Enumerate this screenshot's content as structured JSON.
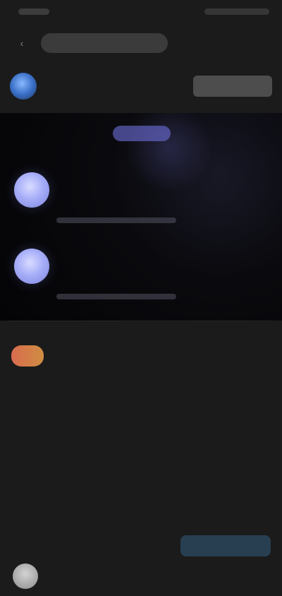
{
  "status_bar": {
    "time": "",
    "indicators": ""
  },
  "top_bar": {
    "title": "",
    "back_icon": "chevron-left-icon"
  },
  "channel": {
    "name": "",
    "subtitle": "",
    "button": ""
  },
  "hero": {
    "chip": "",
    "caption": "",
    "poll_1": {
      "title": "",
      "subtitle": ""
    },
    "poll_2": {
      "title": "",
      "subtitle": ""
    }
  },
  "body": {
    "paragraph_1": "",
    "paragraph_2": "",
    "paragraph_3": "",
    "user_name": "",
    "user_time": "",
    "reply_meta": ""
  },
  "actions": {
    "left_text": "",
    "blue_button": ""
  },
  "colors": {
    "background": "#1b1b1b",
    "hero_background": "#050507",
    "accent_purple": "#7c83de",
    "accent_blue": "#335c80",
    "accent_orange": "#d96c4f"
  }
}
